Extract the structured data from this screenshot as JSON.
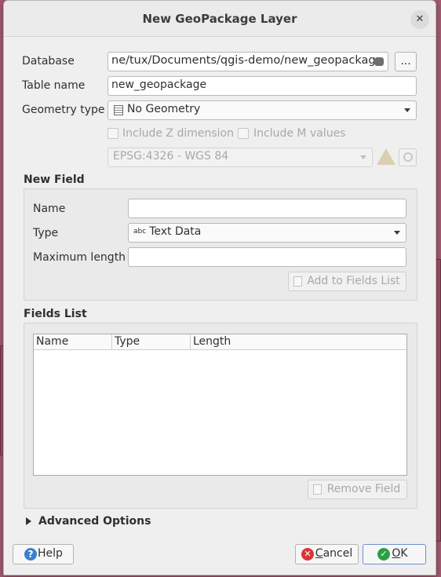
{
  "dialog": {
    "title": "New GeoPackage Layer",
    "close_glyph": "✕"
  },
  "form": {
    "database_label": "Database",
    "database_value": "ne/tux/Documents/qgis-demo/new_geopackage",
    "browse_label": "...",
    "table_name_label": "Table name",
    "table_name_value": "new_geopackage",
    "geometry_type_label": "Geometry type",
    "geometry_type_value": "No Geometry",
    "include_z_label": "Include Z dimension",
    "include_m_label": "Include M values",
    "crs_value": "EPSG:4326 - WGS 84"
  },
  "new_field": {
    "section_title": "New Field",
    "name_label": "Name",
    "name_value": "",
    "type_label": "Type",
    "type_prefix": "abc",
    "type_value": "Text Data",
    "max_length_label": "Maximum length",
    "max_length_value": "",
    "add_button": "Add to Fields List"
  },
  "fields_list": {
    "section_title": "Fields List",
    "columns": [
      "Name",
      "Type",
      "Length"
    ],
    "rows": [],
    "remove_button": "Remove Field"
  },
  "advanced": {
    "label": "Advanced Options"
  },
  "footer": {
    "help_label": "Help",
    "cancel_first": "C",
    "cancel_rest": "ancel",
    "ok_first": "O",
    "ok_rest": "K"
  },
  "colors": {
    "backdrop": "#a35a6f",
    "warning": "#d8b24a",
    "help_blue": "#3b7fd1",
    "cancel_red": "#d93636",
    "ok_green": "#2e9e44"
  }
}
